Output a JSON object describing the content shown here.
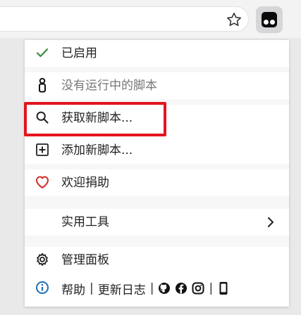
{
  "browser": {
    "bookmark_icon": "star-outline-icon",
    "extension_icon": "tampermonkey-icon"
  },
  "menu": {
    "enabled": {
      "icon": "checkmark-icon",
      "label": "已启用"
    },
    "no_scripts": {
      "icon": "tampermonkey-figure-icon",
      "label": "没有运行中的脚本"
    },
    "get_new_scripts": {
      "icon": "search-icon",
      "label": "获取新脚本..."
    },
    "add_new_script": {
      "icon": "plus-box-icon",
      "label": "添加新脚本..."
    },
    "donate": {
      "icon": "heart-icon",
      "label": "欢迎捐助"
    },
    "utilities": {
      "label": "实用工具",
      "submenu_icon": "chevron-right-icon"
    },
    "dashboard": {
      "icon": "gear-icon",
      "label": "管理面板"
    },
    "footer": {
      "icon": "info-icon",
      "help": "帮助",
      "separator": "|",
      "changelog": "更新日志",
      "links": [
        "github-icon",
        "facebook-icon",
        "instagram-icon",
        "mobile-icon"
      ]
    }
  },
  "colors": {
    "check_green": "#3c8b3c",
    "heart_red": "#d62b2b",
    "info_blue": "#1f6fb5",
    "highlight_red": "#e3151e"
  }
}
